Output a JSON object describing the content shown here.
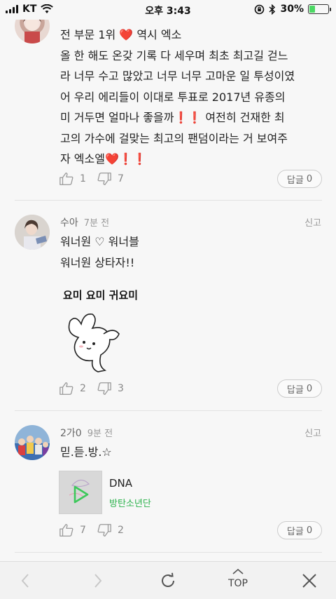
{
  "status": {
    "carrier": "KT",
    "time": "오후 3:43",
    "battery": "30%",
    "battery_level": 0.3
  },
  "comments": [
    {
      "text_lines": [
        "전 부문 1위 ❤️ 역시 엑소",
        "올 한 해도 온갖 기록 다 세우며 최초 최고길 걷느",
        "라 너무 수고 많았고 너무 너무 고마운 일 투성이였",
        "어 우리 에리들이 이대로 투표로 2017년 유종의",
        "미 거두면 얼마나 좋을까❗❗ 여전히 건재한 최",
        "고의 가수에 걸맞는 최고의 팬덤이라는 거 보여주",
        "자 엑소엘❤️❗❗"
      ],
      "likes": "1",
      "dislikes": "7",
      "reply_label": "답글",
      "reply_count": "0"
    },
    {
      "author": "수아",
      "time": "7분 전",
      "report_label": "신고",
      "text_lines": [
        "워너원 ♡ 워너블",
        "워너원 상타자!!"
      ],
      "sticker_caption": "요미 요미 귀요미",
      "likes": "2",
      "dislikes": "3",
      "reply_label": "답글",
      "reply_count": "0"
    },
    {
      "author": "2가0",
      "time": "9분 전",
      "report_label": "신고",
      "text_lines": [
        "믿.듣.방.☆"
      ],
      "music": {
        "title": "DNA",
        "artist": "방탄소년단"
      },
      "likes": "7",
      "dislikes": "2",
      "reply_label": "답글",
      "reply_count": "0"
    }
  ],
  "bottom_bar": {
    "back_icon": "chevron-left",
    "forward_icon": "chevron-right",
    "refresh_icon": "refresh",
    "top_label": "TOP",
    "close_icon": "close"
  },
  "colors": {
    "accent_green": "#2bb24c",
    "heart_red": "#e0202a",
    "background": "#f7f7f7"
  }
}
